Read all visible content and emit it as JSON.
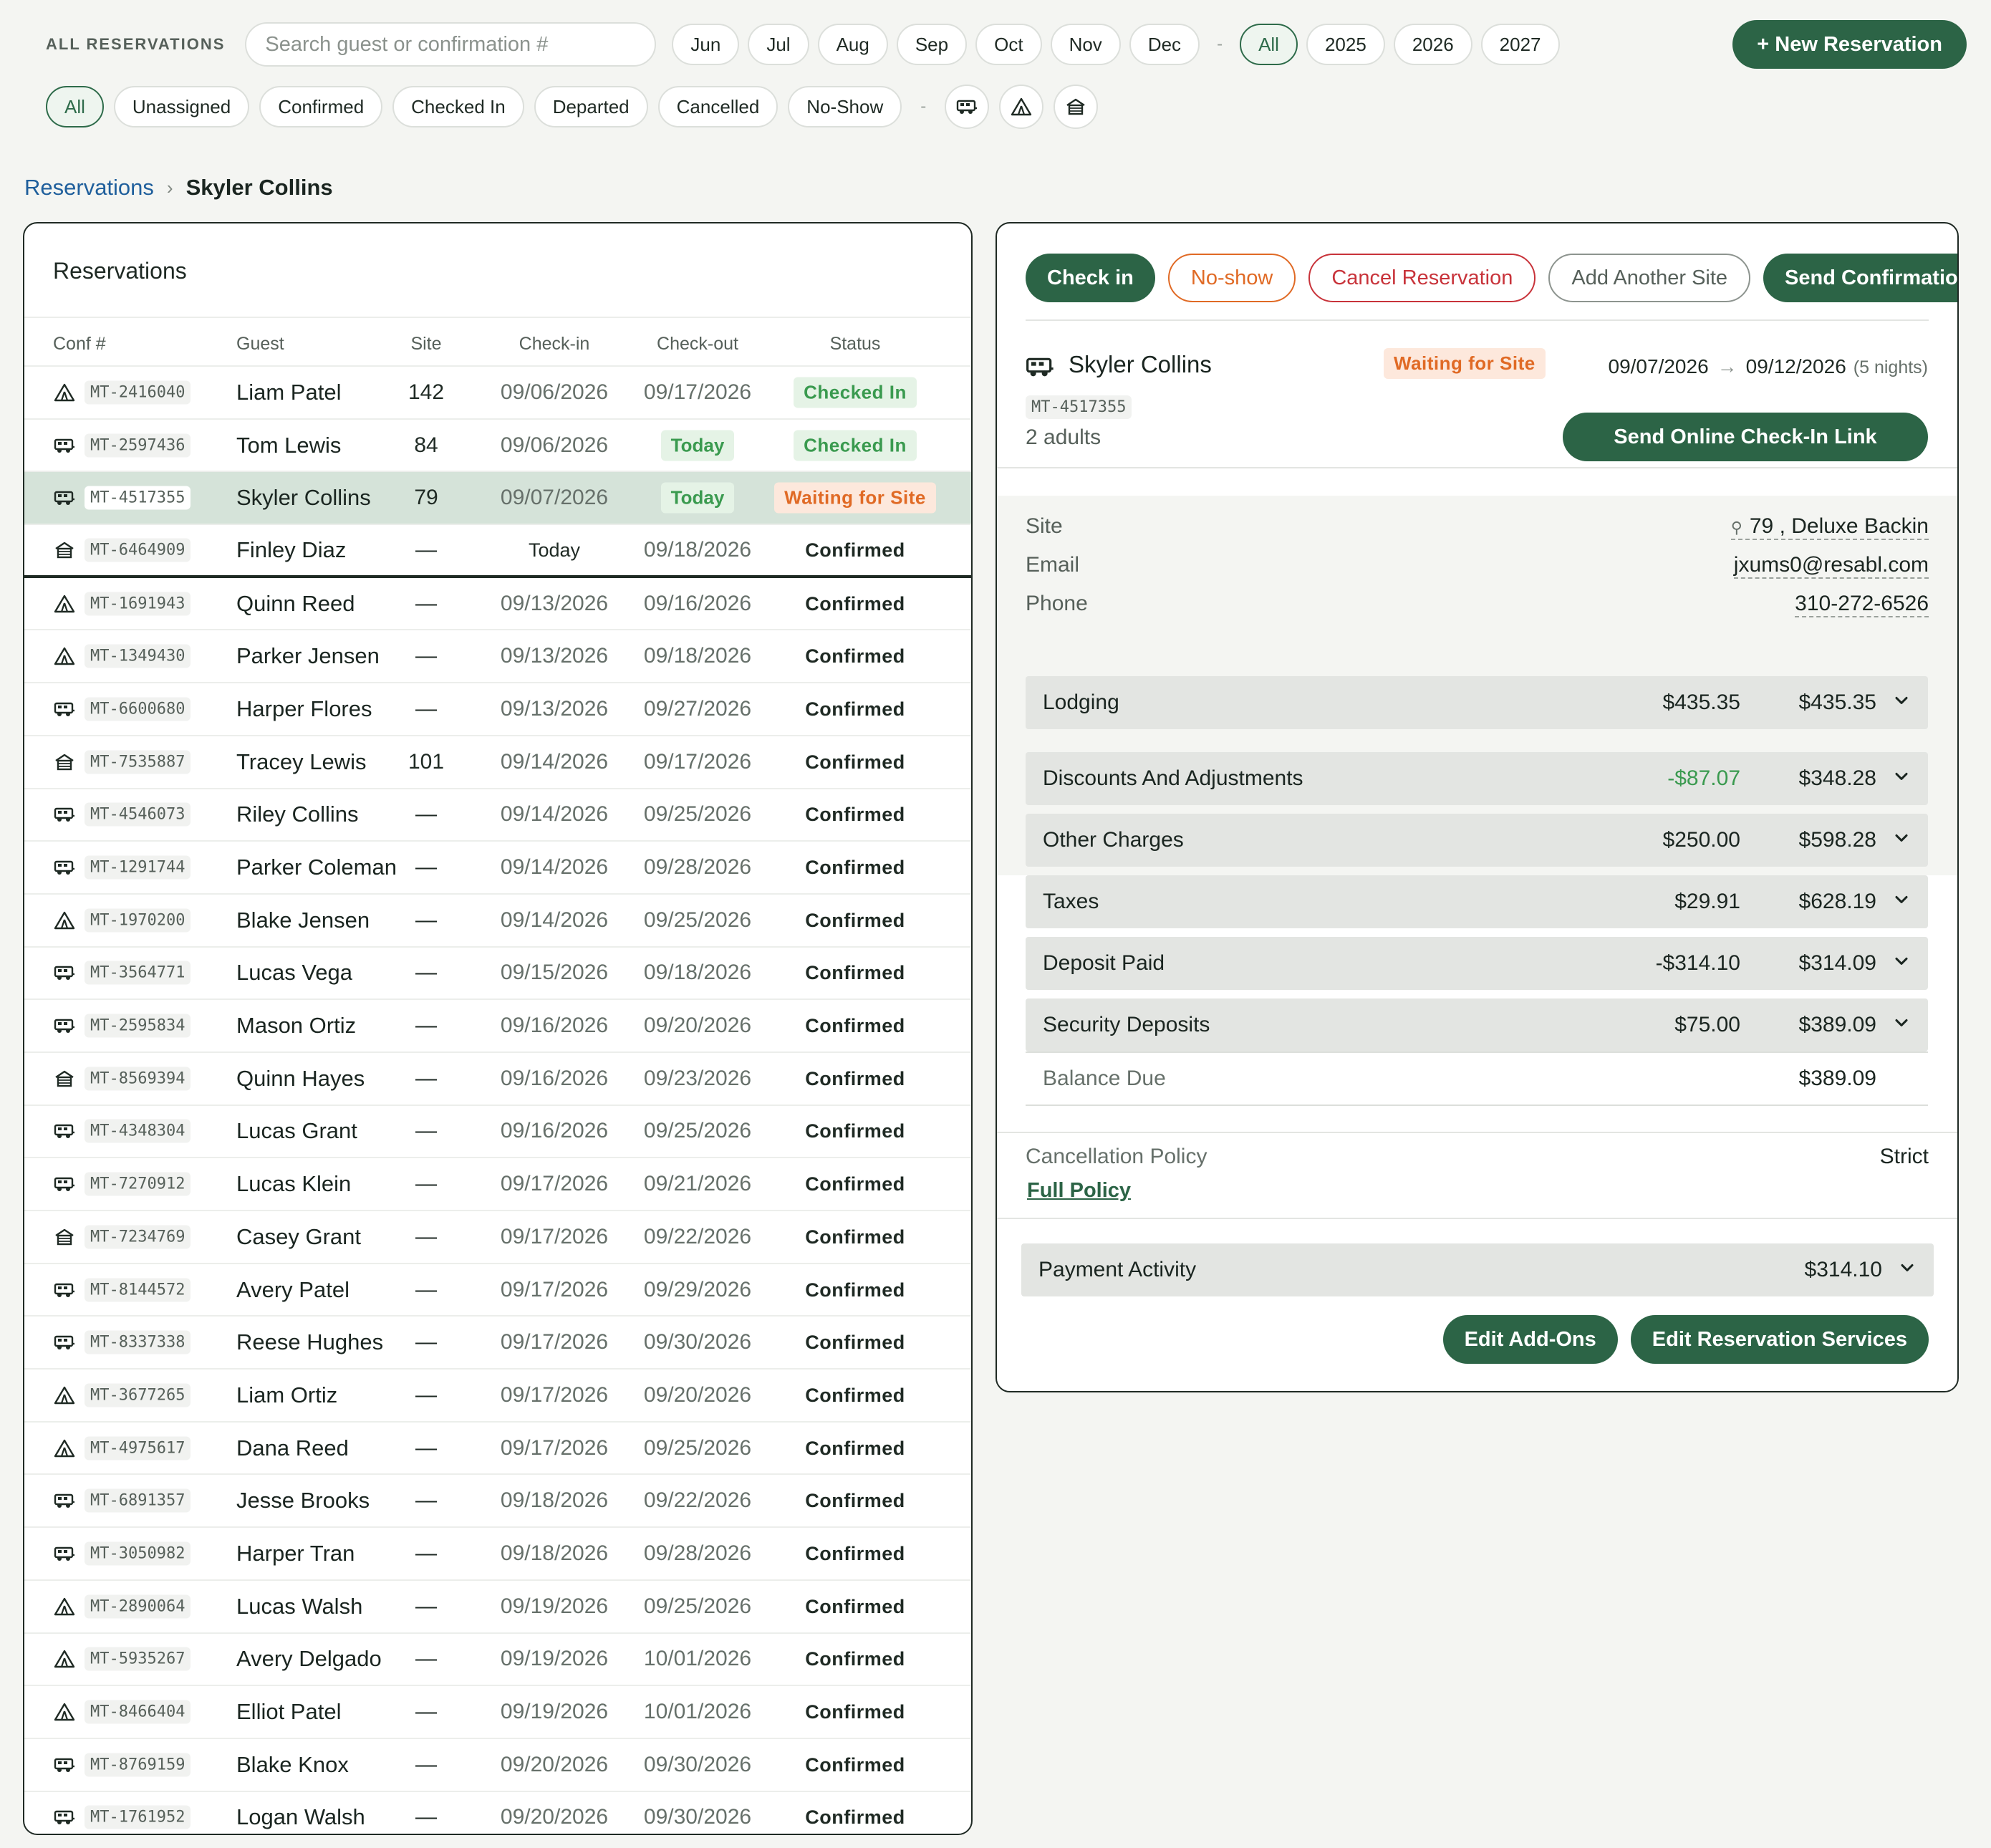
{
  "header": {
    "all_reservations_label": "ALL RESERVATIONS",
    "search_placeholder": "Search guest or confirmation #",
    "months": [
      "Jun",
      "Jul",
      "Aug",
      "Sep",
      "Oct",
      "Nov",
      "Dec"
    ],
    "dash": "-",
    "years": [
      "All",
      "2025",
      "2026",
      "2027"
    ],
    "active_year": "All",
    "new_reservation": "+ New Reservation",
    "statuses": [
      "All",
      "Unassigned",
      "Confirmed",
      "Checked In",
      "Departed",
      "Cancelled",
      "No-Show"
    ],
    "active_status": "All",
    "type_icons": [
      "rv-icon",
      "tent-icon",
      "cabin-icon"
    ]
  },
  "breadcrumb": {
    "parent": "Reservations",
    "separator": "›",
    "current": "Skyler Collins"
  },
  "list": {
    "title": "Reservations",
    "columns": {
      "conf": "Conf #",
      "guest": "Guest",
      "site": "Site",
      "checkin": "Check-in",
      "checkout": "Check-out",
      "status": "Status"
    },
    "rows": [
      {
        "type": "tent",
        "conf": "MT-2416040",
        "guest": "Liam Patel",
        "site": "142",
        "checkin": "09/06/2026",
        "checkout": "09/17/2026",
        "status": "Checked In"
      },
      {
        "type": "rv",
        "conf": "MT-2597436",
        "guest": "Tom Lewis",
        "site": "84",
        "checkin": "09/06/2026",
        "checkout": "Today",
        "status": "Checked In"
      },
      {
        "type": "rv",
        "conf": "MT-4517355",
        "guest": "Skyler Collins",
        "site": "79",
        "checkin": "09/07/2026",
        "checkout": "Today",
        "status": "Waiting for Site",
        "selected": true
      },
      {
        "type": "cabin",
        "conf": "MT-6464909",
        "guest": "Finley Diaz",
        "site": "—",
        "checkin": "Today",
        "checkout": "09/18/2026",
        "status": "Confirmed",
        "divider": true
      },
      {
        "type": "tent",
        "conf": "MT-1691943",
        "guest": "Quinn Reed",
        "site": "—",
        "checkin": "09/13/2026",
        "checkout": "09/16/2026",
        "status": "Confirmed"
      },
      {
        "type": "tent",
        "conf": "MT-1349430",
        "guest": "Parker Jensen",
        "site": "—",
        "checkin": "09/13/2026",
        "checkout": "09/18/2026",
        "status": "Confirmed"
      },
      {
        "type": "rv",
        "conf": "MT-6600680",
        "guest": "Harper Flores",
        "site": "—",
        "checkin": "09/13/2026",
        "checkout": "09/27/2026",
        "status": "Confirmed"
      },
      {
        "type": "cabin",
        "conf": "MT-7535887",
        "guest": "Tracey Lewis",
        "site": "101",
        "checkin": "09/14/2026",
        "checkout": "09/17/2026",
        "status": "Confirmed"
      },
      {
        "type": "rv",
        "conf": "MT-4546073",
        "guest": "Riley Collins",
        "site": "—",
        "checkin": "09/14/2026",
        "checkout": "09/25/2026",
        "status": "Confirmed"
      },
      {
        "type": "rv",
        "conf": "MT-1291744",
        "guest": "Parker Coleman",
        "site": "—",
        "checkin": "09/14/2026",
        "checkout": "09/28/2026",
        "status": "Confirmed"
      },
      {
        "type": "tent",
        "conf": "MT-1970200",
        "guest": "Blake Jensen",
        "site": "—",
        "checkin": "09/14/2026",
        "checkout": "09/25/2026",
        "status": "Confirmed"
      },
      {
        "type": "rv",
        "conf": "MT-3564771",
        "guest": "Lucas Vega",
        "site": "—",
        "checkin": "09/15/2026",
        "checkout": "09/18/2026",
        "status": "Confirmed"
      },
      {
        "type": "rv",
        "conf": "MT-2595834",
        "guest": "Mason Ortiz",
        "site": "—",
        "checkin": "09/16/2026",
        "checkout": "09/20/2026",
        "status": "Confirmed"
      },
      {
        "type": "cabin",
        "conf": "MT-8569394",
        "guest": "Quinn Hayes",
        "site": "—",
        "checkin": "09/16/2026",
        "checkout": "09/23/2026",
        "status": "Confirmed"
      },
      {
        "type": "rv",
        "conf": "MT-4348304",
        "guest": "Lucas Grant",
        "site": "—",
        "checkin": "09/16/2026",
        "checkout": "09/25/2026",
        "status": "Confirmed"
      },
      {
        "type": "rv",
        "conf": "MT-7270912",
        "guest": "Lucas Klein",
        "site": "—",
        "checkin": "09/17/2026",
        "checkout": "09/21/2026",
        "status": "Confirmed"
      },
      {
        "type": "cabin",
        "conf": "MT-7234769",
        "guest": "Casey Grant",
        "site": "—",
        "checkin": "09/17/2026",
        "checkout": "09/22/2026",
        "status": "Confirmed"
      },
      {
        "type": "rv",
        "conf": "MT-8144572",
        "guest": "Avery Patel",
        "site": "—",
        "checkin": "09/17/2026",
        "checkout": "09/29/2026",
        "status": "Confirmed"
      },
      {
        "type": "rv",
        "conf": "MT-8337338",
        "guest": "Reese Hughes",
        "site": "—",
        "checkin": "09/17/2026",
        "checkout": "09/30/2026",
        "status": "Confirmed"
      },
      {
        "type": "tent",
        "conf": "MT-3677265",
        "guest": "Liam Ortiz",
        "site": "—",
        "checkin": "09/17/2026",
        "checkout": "09/20/2026",
        "status": "Confirmed"
      },
      {
        "type": "tent",
        "conf": "MT-4975617",
        "guest": "Dana Reed",
        "site": "—",
        "checkin": "09/17/2026",
        "checkout": "09/25/2026",
        "status": "Confirmed"
      },
      {
        "type": "rv",
        "conf": "MT-6891357",
        "guest": "Jesse Brooks",
        "site": "—",
        "checkin": "09/18/2026",
        "checkout": "09/22/2026",
        "status": "Confirmed"
      },
      {
        "type": "rv",
        "conf": "MT-3050982",
        "guest": "Harper Tran",
        "site": "—",
        "checkin": "09/18/2026",
        "checkout": "09/28/2026",
        "status": "Confirmed"
      },
      {
        "type": "tent",
        "conf": "MT-2890064",
        "guest": "Lucas Walsh",
        "site": "—",
        "checkin": "09/19/2026",
        "checkout": "09/25/2026",
        "status": "Confirmed"
      },
      {
        "type": "tent",
        "conf": "MT-5935267",
        "guest": "Avery Delgado",
        "site": "—",
        "checkin": "09/19/2026",
        "checkout": "10/01/2026",
        "status": "Confirmed"
      },
      {
        "type": "tent",
        "conf": "MT-8466404",
        "guest": "Elliot Patel",
        "site": "—",
        "checkin": "09/19/2026",
        "checkout": "10/01/2026",
        "status": "Confirmed"
      },
      {
        "type": "rv",
        "conf": "MT-8769159",
        "guest": "Blake Knox",
        "site": "—",
        "checkin": "09/20/2026",
        "checkout": "09/30/2026",
        "status": "Confirmed"
      },
      {
        "type": "rv",
        "conf": "MT-1761952",
        "guest": "Logan Walsh",
        "site": "—",
        "checkin": "09/20/2026",
        "checkout": "09/30/2026",
        "status": "Confirmed"
      }
    ]
  },
  "detail": {
    "actions": {
      "check_in": "Check in",
      "no_show": "No-show",
      "cancel": "Cancel Reservation",
      "add_site": "Add Another Site",
      "send_confirmation": "Send Confirmation"
    },
    "guest_name": "Skyler Collins",
    "conf": "MT-4517355",
    "adults": "2 adults",
    "status": "Waiting for Site",
    "checkin": "09/07/2026",
    "arrow": "→",
    "checkout": "09/12/2026",
    "nights": "(5 nights)",
    "send_link": "Send Online Check-In Link",
    "site_label": "Site",
    "site_value": "79 , Deluxe Backin",
    "email_label": "Email",
    "email_value": "jxums0@resabl.com",
    "phone_label": "Phone",
    "phone_value": "310-272-6526",
    "lines": [
      {
        "label": "Lodging",
        "amount": "$435.35",
        "total": "$435.35"
      },
      {
        "label": "Discounts And Adjustments",
        "amount": "-$87.07",
        "total": "$348.28",
        "green": true
      },
      {
        "label": "Other Charges",
        "amount": "$250.00",
        "total": "$598.28"
      },
      {
        "label": "Taxes",
        "amount": "$29.91",
        "total": "$628.19"
      },
      {
        "label": "Deposit Paid",
        "amount": "-$314.10",
        "total": "$314.09"
      },
      {
        "label": "Security Deposits",
        "amount": "$75.00",
        "total": "$389.09"
      }
    ],
    "balance_label": "Balance Due",
    "balance_total": "$389.09",
    "cancellation_label": "Cancellation Policy",
    "cancellation_value": "Strict",
    "full_policy": "Full Policy",
    "payment_label": "Payment Activity",
    "payment_total": "$314.10",
    "edit_addons": "Edit Add-Ons",
    "edit_services": "Edit Reservation Services"
  },
  "colors": {
    "primary": "#2c6446",
    "orange": "#e06a25",
    "red": "#c8333a",
    "green_text": "#3a9a4f",
    "selected_row": "#d5e3d9"
  }
}
